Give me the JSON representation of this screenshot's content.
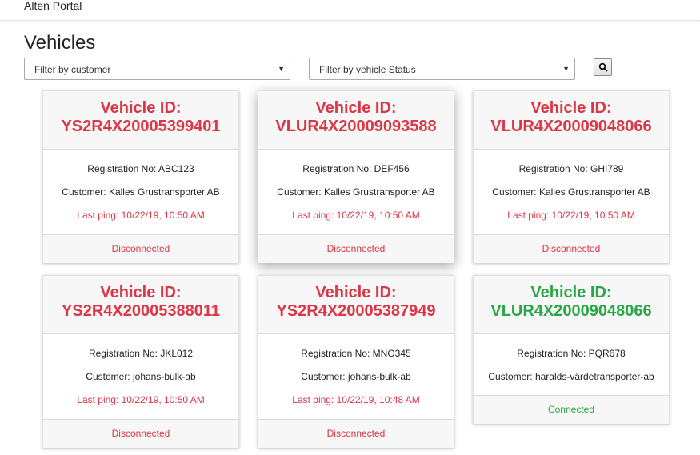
{
  "app": {
    "brand": "Alten Portal"
  },
  "page": {
    "title": "Vehicles"
  },
  "filters": {
    "customer_placeholder": "Filter by customer",
    "status_placeholder": "Filter by vehicle Status",
    "search_icon": "magnifier-icon"
  },
  "colors": {
    "disconnected": "#dc3545",
    "connected": "#28a745"
  },
  "vehicles": [
    {
      "id_label": "Vehicle ID:",
      "id": "YS2R4X20005399401",
      "registration": "Registration No: ABC123",
      "customer": "Customer: Kalles Grustransporter AB",
      "last_ping": "Last ping: 10/22/19, 10:50 AM",
      "status": "Disconnected"
    },
    {
      "id_label": "Vehicle ID:",
      "id": "VLUR4X20009093588",
      "registration": "Registration No: DEF456",
      "customer": "Customer: Kalles Grustransporter AB",
      "last_ping": "Last ping: 10/22/19, 10:50 AM",
      "status": "Disconnected"
    },
    {
      "id_label": "Vehicle ID:",
      "id": "VLUR4X20009048066",
      "registration": "Registration No: GHI789",
      "customer": "Customer: Kalles Grustransporter AB",
      "last_ping": "Last ping: 10/22/19, 10:50 AM",
      "status": "Disconnected"
    },
    {
      "id_label": "Vehicle ID:",
      "id": "YS2R4X20005388011",
      "registration": "Registration No: JKL012",
      "customer": "Customer: johans-bulk-ab",
      "last_ping": "Last ping: 10/22/19, 10:50 AM",
      "status": "Disconnected"
    },
    {
      "id_label": "Vehicle ID:",
      "id": "YS2R4X20005387949",
      "registration": "Registration No: MNO345",
      "customer": "Customer: johans-bulk-ab",
      "last_ping": "Last ping: 10/22/19, 10:48 AM",
      "status": "Disconnected"
    },
    {
      "id_label": "Vehicle ID:",
      "id": "VLUR4X20009048066",
      "registration": "Registration No: PQR678",
      "customer": "Customer: haralds-värdetransporter-ab",
      "status": "Connected"
    }
  ]
}
